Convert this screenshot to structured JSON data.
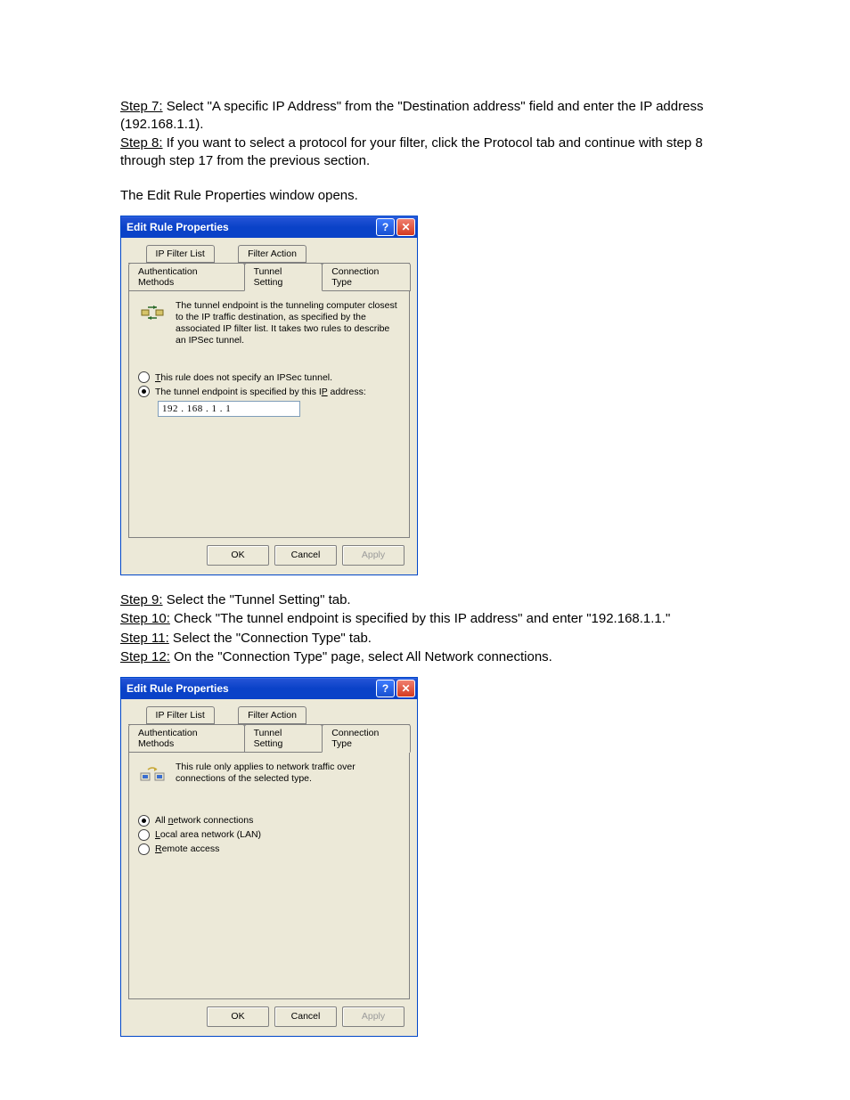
{
  "doc": {
    "step7_label": "Step 7:",
    "step7_text": " Select \"A specific IP Address\" from the \"Destination address\" field and enter the IP address (192.168.1.1).",
    "step8_label": "Step 8:",
    "step8_text": " If you want to select a protocol for your filter, click the Protocol tab and continue with step 8 through step 17 from the previous section.",
    "edit_opens": "The Edit Rule Properties window opens.",
    "step9_label": "Step 9:",
    "step9_text": " Select the \"Tunnel Setting\" tab.",
    "step10_label": "Step 10:",
    "step10_text": " Check \"The tunnel endpoint is specified by this IP address\" and enter \"192.168.1.1.\"",
    "step11_label": "Step 11:",
    "step11_text": " Select the \"Connection Type\" tab.",
    "step12_label": "Step 12:",
    "step12_text": " On the \"Connection Type\" page, select All Network connections."
  },
  "dialog1": {
    "title": "Edit Rule Properties",
    "tabs_row1": [
      "IP Filter List",
      "Filter Action"
    ],
    "tabs_row2": [
      "Authentication Methods",
      "Tunnel Setting",
      "Connection Type"
    ],
    "active_tab": "Tunnel Setting",
    "desc": "The tunnel endpoint is the tunneling computer closest to the IP traffic destination, as specified by the associated IP filter list. It takes two rules to describe an IPSec tunnel.",
    "radio1_pre": "T",
    "radio1_rest": "his rule does not specify an IPSec tunnel.",
    "radio2_pre": "The tunnel endpoint is specified by this I",
    "radio2_u": "P",
    "radio2_post": " address:",
    "ip_value": "192 . 168 .   1   .   1",
    "selected_radio": 1,
    "buttons": {
      "ok": "OK",
      "cancel": "Cancel",
      "apply": "Apply"
    }
  },
  "dialog2": {
    "title": "Edit Rule Properties",
    "tabs_row1": [
      "IP Filter List",
      "Filter Action"
    ],
    "tabs_row2": [
      "Authentication Methods",
      "Tunnel Setting",
      "Connection Type"
    ],
    "active_tab": "Connection Type",
    "desc": "This rule only applies to network traffic over connections of the selected type.",
    "radios": [
      {
        "pre": "All ",
        "u": "n",
        "post": "etwork connections"
      },
      {
        "pre": "",
        "u": "L",
        "post": "ocal area network (LAN)"
      },
      {
        "pre": "",
        "u": "R",
        "post": "emote access"
      }
    ],
    "selected_radio": 0,
    "buttons": {
      "ok": "OK",
      "cancel": "Cancel",
      "apply": "Apply"
    }
  }
}
